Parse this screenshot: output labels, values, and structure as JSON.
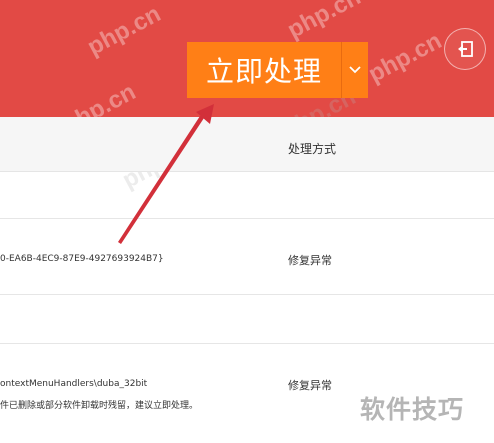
{
  "header": {
    "primary_button_label": "立即处理",
    "watermarks": [
      "php.cn",
      "php.cn",
      "php.cn",
      "php.cn",
      "php.cn",
      "php.cn"
    ]
  },
  "table": {
    "column_header": "处理方式",
    "rows": [
      {
        "path": "0-EA6B-4EC9-87E9-4927693924B7}",
        "action": "修复异常"
      },
      {
        "path": "ontextMenuHandlers\\duba_32bit",
        "description": "件已删除或部分软件卸载时残留，建议立即处理。",
        "action": "修复异常"
      }
    ]
  },
  "brand_watermark": "软件技巧",
  "colors": {
    "header_bg": "#e24a45",
    "primary_button": "#ff7f16",
    "arrow": "#d2303a"
  }
}
